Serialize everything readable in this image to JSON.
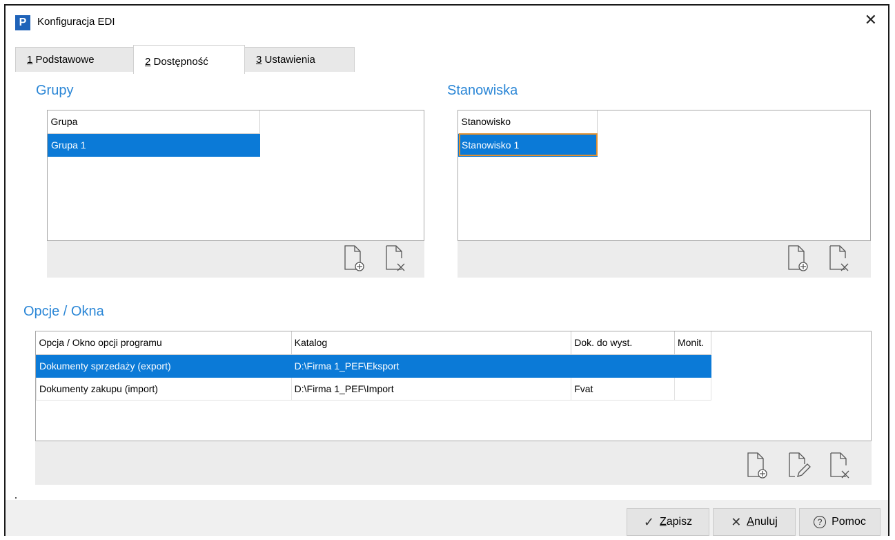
{
  "window": {
    "title": "Konfiguracja EDI",
    "app_icon_letter": "P",
    "close_glyph": "✕"
  },
  "tabs": [
    {
      "key": "1",
      "label": " Podstawowe"
    },
    {
      "key": "2",
      "label": " Dostępność"
    },
    {
      "key": "3",
      "label": " Ustawienia"
    }
  ],
  "groups": {
    "title": "Grupy",
    "column": "Grupa",
    "rows": [
      "Grupa 1"
    ]
  },
  "workstations": {
    "title": "Stanowiska",
    "column": "Stanowisko",
    "rows": [
      "Stanowisko 1"
    ]
  },
  "options": {
    "title": "Opcje / Okna",
    "columns": [
      "Opcja / Okno opcji programu",
      "Katalog",
      "Dok. do wyst.",
      "Monit."
    ],
    "rows": [
      [
        "Dokumenty sprzedaży (export)",
        "D:\\Firma 1_PEF\\Eksport",
        "",
        ""
      ],
      [
        "Dokumenty zakupu (import)",
        "D:\\Firma 1_PEF\\Import",
        "Fvat",
        ""
      ]
    ]
  },
  "buttons": {
    "save": {
      "key": "Z",
      "rest": "apisz",
      "glyph": "✓"
    },
    "cancel": {
      "key": "A",
      "rest": "nuluj",
      "glyph": "✕"
    },
    "help": {
      "label": "Pomoc",
      "glyph": "?"
    }
  }
}
